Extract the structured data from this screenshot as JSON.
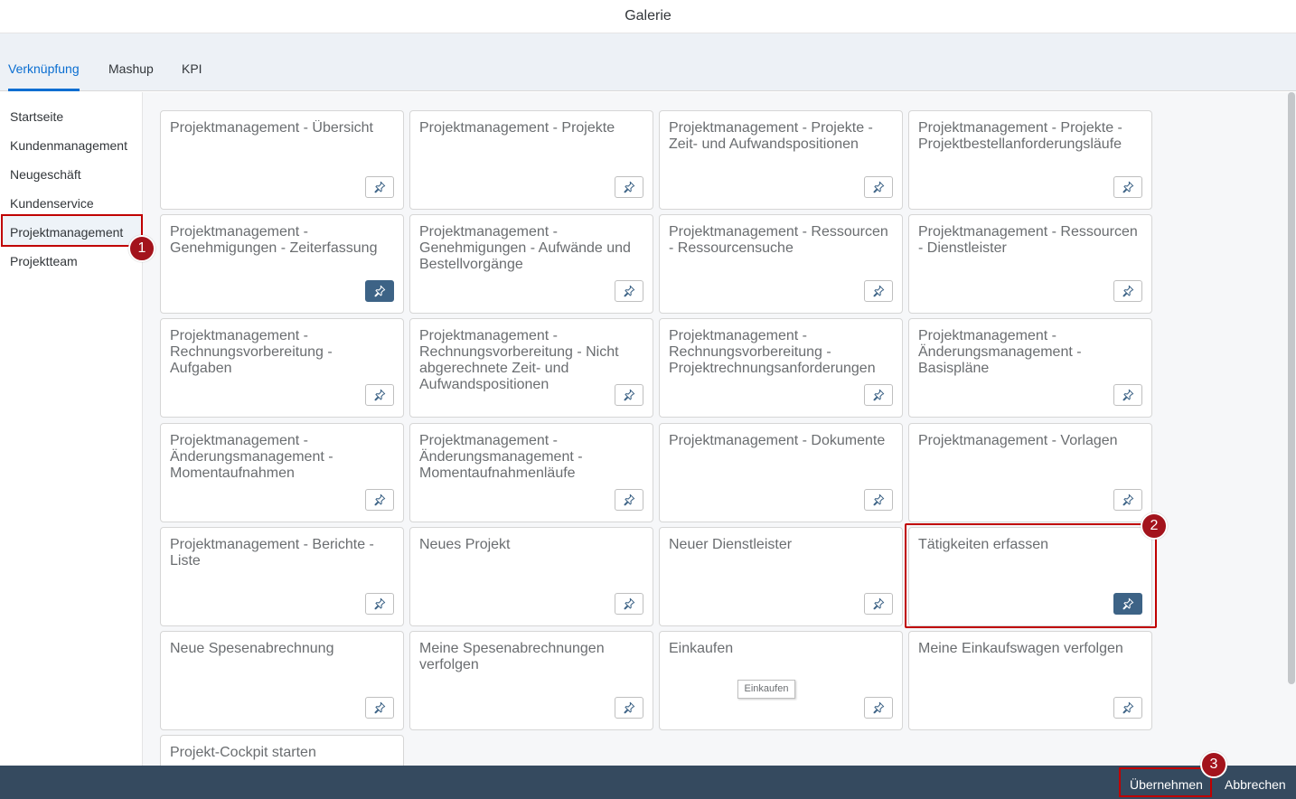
{
  "window": {
    "title": "Galerie"
  },
  "tabs": [
    {
      "label": "Verknüpfung"
    },
    {
      "label": "Mashup"
    },
    {
      "label": "KPI"
    }
  ],
  "sidebar": {
    "items": [
      {
        "label": "Startseite"
      },
      {
        "label": "Kundenmanagement"
      },
      {
        "label": "Neugeschäft"
      },
      {
        "label": "Kundenservice"
      },
      {
        "label": "Projektmanagement"
      },
      {
        "label": "Projektteam"
      }
    ]
  },
  "tiles": [
    {
      "title": "Projektmanagement - Übersicht",
      "pinned": false
    },
    {
      "title": "Projektmanagement - Projekte",
      "pinned": false
    },
    {
      "title": "Projektmanagement - Projekte - Zeit- und Aufwandspositionen",
      "pinned": false
    },
    {
      "title": "Projektmanagement - Projekte - Projektbestellanforderungsläufe",
      "pinned": false
    },
    {
      "title": "Projektmanagement - Genehmigungen - Zeiterfassung",
      "pinned": true
    },
    {
      "title": "Projektmanagement - Genehmigungen - Aufwände und Bestellvorgänge",
      "pinned": false
    },
    {
      "title": "Projektmanagement - Ressourcen - Ressourcensuche",
      "pinned": false
    },
    {
      "title": "Projektmanagement - Ressourcen - Dienstleister",
      "pinned": false
    },
    {
      "title": "Projektmanagement - Rechnungsvorbereitung - Aufgaben",
      "pinned": false
    },
    {
      "title": "Projektmanagement - Rechnungsvorbereitung - Nicht abgerechnete Zeit- und Aufwandspositionen",
      "pinned": false
    },
    {
      "title": "Projektmanagement - Rechnungsvorbereitung - Projektrechnungsanforderungen",
      "pinned": false
    },
    {
      "title": "Projektmanagement - Änderungsmanagement - Basispläne",
      "pinned": false
    },
    {
      "title": "Projektmanagement - Änderungsmanagement - Momentaufnahmen",
      "pinned": false
    },
    {
      "title": "Projektmanagement - Änderungsmanagement - Momentaufnahmenläufe",
      "pinned": false
    },
    {
      "title": "Projektmanagement - Dokumente",
      "pinned": false
    },
    {
      "title": "Projektmanagement - Vorlagen",
      "pinned": false
    },
    {
      "title": "Projektmanagement - Berichte - Liste",
      "pinned": false
    },
    {
      "title": "Neues Projekt",
      "pinned": false
    },
    {
      "title": "Neuer Dienstleister",
      "pinned": false
    },
    {
      "title": "Tätigkeiten erfassen",
      "pinned": true
    },
    {
      "title": "Neue Spesenabrechnung",
      "pinned": false
    },
    {
      "title": "Meine Spesenabrechnungen verfolgen",
      "pinned": false
    },
    {
      "title": "Einkaufen",
      "pinned": false
    },
    {
      "title": "Meine Einkaufswagen verfolgen",
      "pinned": false
    },
    {
      "title": "Projekt-Cockpit starten",
      "pinned": false
    }
  ],
  "tooltip": {
    "text": "Einkaufen"
  },
  "footer": {
    "apply_label": "Übernehmen",
    "cancel_label": "Abbrechen"
  },
  "callouts": [
    "1",
    "2",
    "3"
  ],
  "colors": {
    "accent": "#0a6ed1",
    "pinned": "#3d6386",
    "footer": "#354a5f",
    "highlight": "#c00000",
    "badge": "#a3131c"
  },
  "icons": {
    "pin": "pin-icon"
  }
}
